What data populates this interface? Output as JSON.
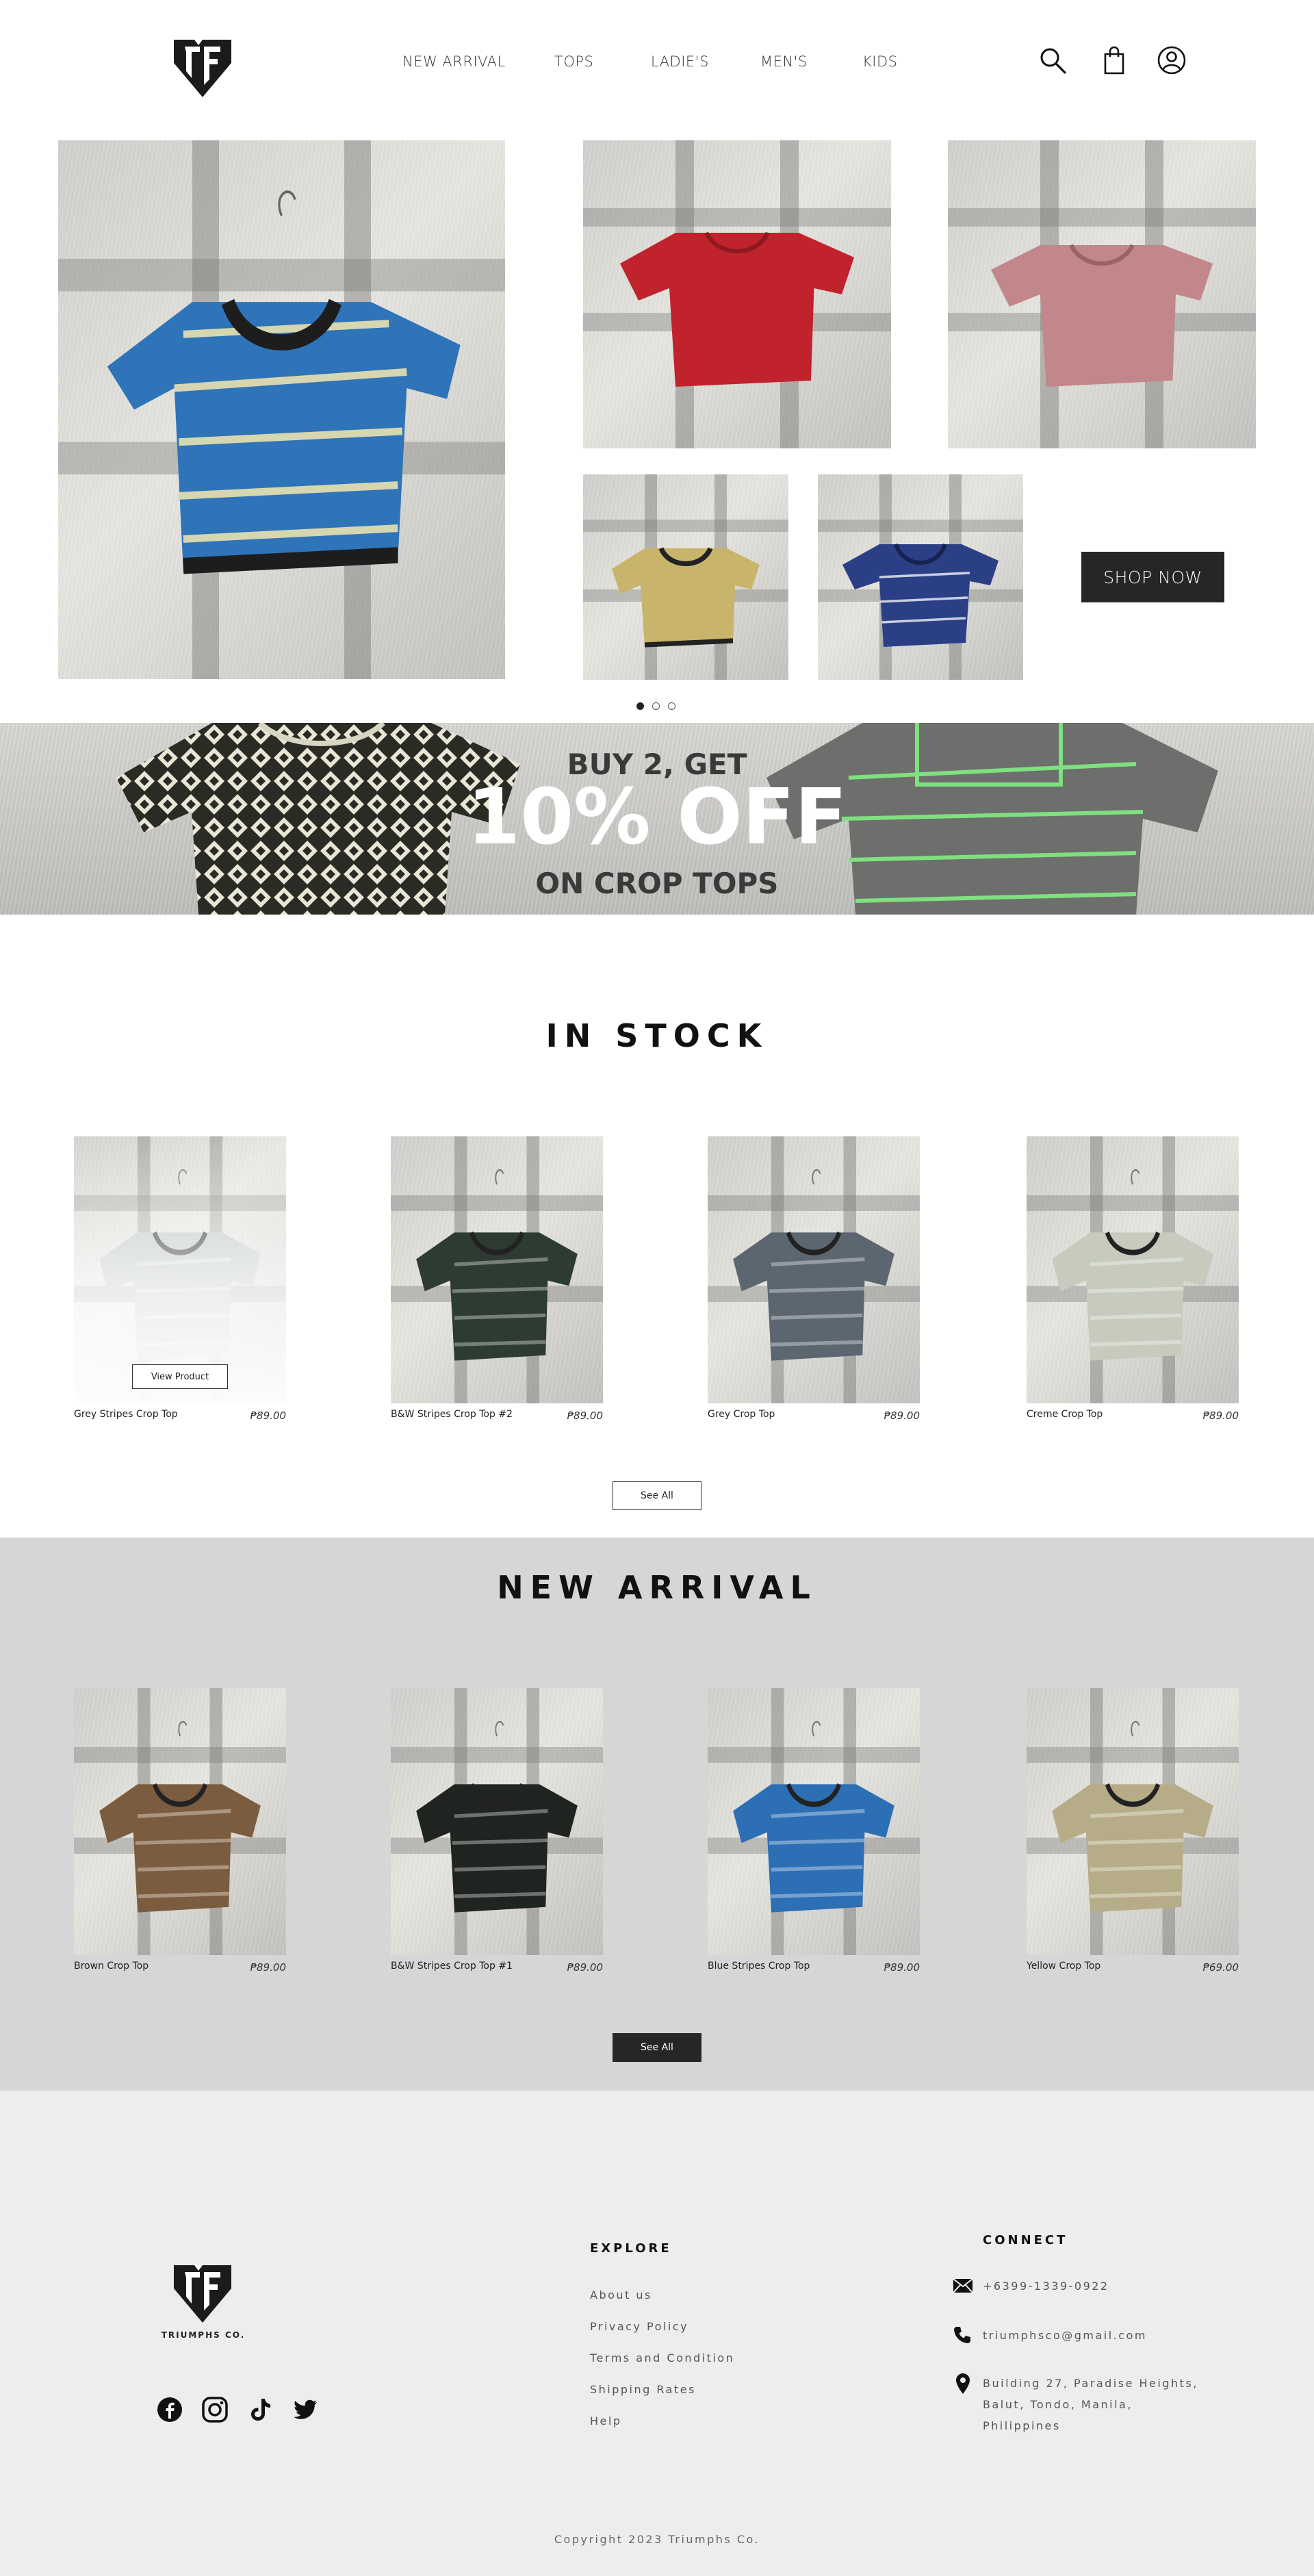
{
  "header": {
    "nav": [
      "NEW ARRIVAL",
      "TOPS",
      "LADIE'S",
      "MEN'S",
      "KIDS"
    ],
    "icons": [
      "search-icon",
      "shopping-bag-icon",
      "user-account-icon"
    ]
  },
  "hero": {
    "shop_now_label": "SHOP NOW",
    "carousel_pages": 3,
    "carousel_active_page": 1,
    "shirt_colors": {
      "main": "#2f73b8",
      "top_left": "#c0232c",
      "top_right": "#c2878a",
      "bottom_left": "#c9b46b",
      "bottom_right": "#2a3f86"
    }
  },
  "promo": {
    "line1": "BUY 2, GET",
    "line2": "10% OFF",
    "line3": "ON CROP TOPS"
  },
  "in_stock": {
    "title": "IN STOCK",
    "view_product_label": "View Product",
    "see_all_label": "See All",
    "products": [
      {
        "name": "Grey Stripes Crop Top",
        "price": "₱89.00",
        "color": "#b9c2bd"
      },
      {
        "name": "B&W Stripes Crop Top #2",
        "price": "₱89.00",
        "color": "#2d3b33"
      },
      {
        "name": "Grey Crop Top",
        "price": "₱89.00",
        "color": "#5b6670"
      },
      {
        "name": "Creme Crop Top",
        "price": "₱89.00",
        "color": "#c6cbbe"
      }
    ]
  },
  "new_arrival": {
    "title": "NEW ARRIVAL",
    "see_all_label": "See All",
    "products": [
      {
        "name": "Brown Crop Top",
        "price": "₱89.00",
        "color": "#7b5c3f"
      },
      {
        "name": "B&W Stripes Crop Top #1",
        "price": "₱89.00",
        "color": "#1f2420"
      },
      {
        "name": "Blue Stripes Crop Top",
        "price": "₱89.00",
        "color": "#2d6fb5"
      },
      {
        "name": "Yellow Crop Top",
        "price": "₱69.00",
        "color": "#b6ad88"
      }
    ]
  },
  "footer": {
    "brand": "TRIUMPHS CO.",
    "explore_title": "EXPLORE",
    "explore_links": [
      "About us",
      "Privacy Policy",
      "Terms and Condition",
      "Shipping Rates",
      "Help"
    ],
    "connect_title": "CONNECT",
    "phone": "+6399-1339-0922",
    "email": "triumphsco@gmail.com",
    "address_lines": [
      "Building 27, Paradise Heights,",
      "Balut, Tondo, Manila,",
      "Philippines"
    ],
    "socials": [
      "facebook-icon",
      "instagram-icon",
      "tiktok-icon",
      "twitter-icon"
    ],
    "copyright": "Copyright 2023 Triumphs Co."
  },
  "colors": {
    "dark_button": "#262626",
    "arrival_background": "#d6d6d6",
    "footer_background": "#ededed"
  }
}
